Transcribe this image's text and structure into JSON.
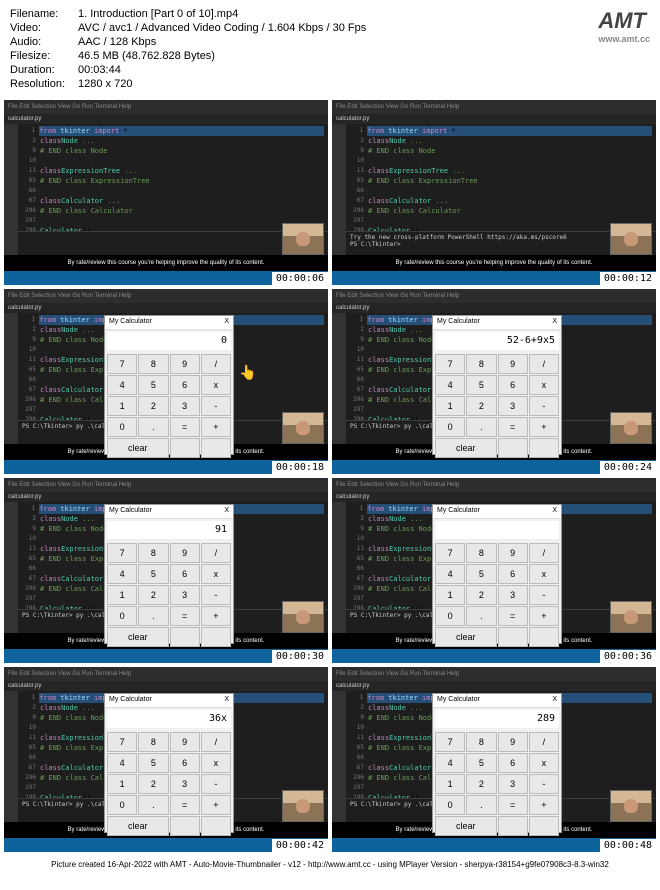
{
  "info": {
    "filename_label": "Filename:",
    "filename": "1. Introduction [Part 0 of 10].mp4",
    "video_label": "Video:",
    "video": "AVC / avc1 / Advanced Video Coding / 1.604 Kbps / 30 Fps",
    "audio_label": "Audio:",
    "audio": "AAC / 128 Kbps",
    "filesize_label": "Filesize:",
    "filesize": "46.5 MB (48.762.828 Bytes)",
    "duration_label": "Duration:",
    "duration": "00:03:44",
    "resolution_label": "Resolution:",
    "resolution": "1280 x 720"
  },
  "logo": {
    "text": "AMT",
    "sub": "www.amt.cc"
  },
  "menu": [
    "File",
    "Edit",
    "Selection",
    "View",
    "Go",
    "Run",
    "Terminal",
    "Help"
  ],
  "tab": "calculator.py",
  "code": {
    "l1": "from tkinter import *",
    "l2": "class Node:",
    "l9": "# END class Node",
    "l11": "class ExpressionTree:",
    "l65": "# END class ExpressionTree",
    "l67": "class Calculator:",
    "l296": "# END class Calculator",
    "l298": "Calculator()"
  },
  "caption": "By rate/review this course you're helping improve the quality of its content.",
  "terminal_ps": "PS C:\\Tkinter>",
  "terminal_cmd": "py .\\calculator.py",
  "terminal_msg": "Try the new cross-platform PowerShell https://aka.ms/pscore6",
  "calc": {
    "title": "My Calculator",
    "close": "X",
    "buttons": [
      "7",
      "8",
      "9",
      "/",
      "4",
      "5",
      "6",
      "x",
      "1",
      "2",
      "3",
      "-",
      "0",
      ".",
      "=",
      "+"
    ],
    "clear": "clear"
  },
  "thumbs": [
    {
      "ts": "00:00:06",
      "calc": false,
      "display": "",
      "terminal": ""
    },
    {
      "ts": "00:00:12",
      "calc": false,
      "display": "",
      "terminal": "msg"
    },
    {
      "ts": "00:00:18",
      "calc": true,
      "display": "0",
      "cursor": true
    },
    {
      "ts": "00:00:24",
      "calc": true,
      "display": "52-6+9x5"
    },
    {
      "ts": "00:00:30",
      "calc": true,
      "display": "91"
    },
    {
      "ts": "00:00:36",
      "calc": true,
      "display": ""
    },
    {
      "ts": "00:00:42",
      "calc": true,
      "display": "36x"
    },
    {
      "ts": "00:00:48",
      "calc": true,
      "display": "289"
    }
  ],
  "footer": "Picture created 16-Apr-2022 with AMT - Auto-Movie-Thumbnailer - v12 - http://www.amt.cc - using MPlayer Version - sherpya-r38154+g9fe07908c3-8.3-win32"
}
